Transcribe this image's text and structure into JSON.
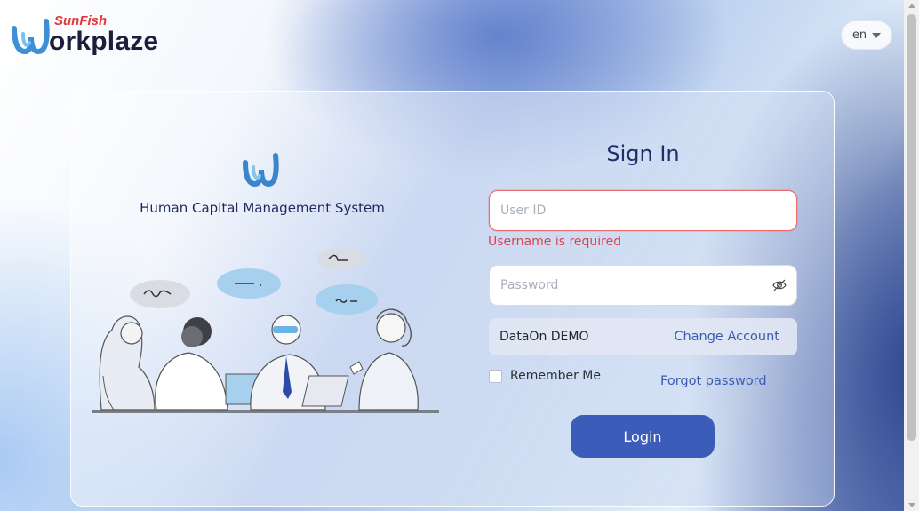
{
  "brand": {
    "sub": "SunFish",
    "main": "orkplaze"
  },
  "language": {
    "selected": "en"
  },
  "left_panel": {
    "subtitle": "Human Capital Management System"
  },
  "login_form": {
    "title": "Sign In",
    "user_id": {
      "value": "",
      "placeholder": "User ID"
    },
    "user_id_error": "Username is required",
    "password": {
      "value": "",
      "placeholder": "Password"
    },
    "account_name": "DataOn DEMO",
    "change_account_label": "Change Account",
    "remember_me_label": "Remember Me",
    "remember_me_checked": false,
    "forgot_password_label": "Forgot password",
    "login_button_label": "Login"
  },
  "colors": {
    "accent": "#3b5cb8",
    "link": "#3a5bb4",
    "error": "#e0424a",
    "title": "#1d2f6a"
  },
  "icons": [
    "workplaze-logo-icon",
    "eye-off-icon",
    "chevron-down-icon",
    "team-meeting-illustration"
  ]
}
